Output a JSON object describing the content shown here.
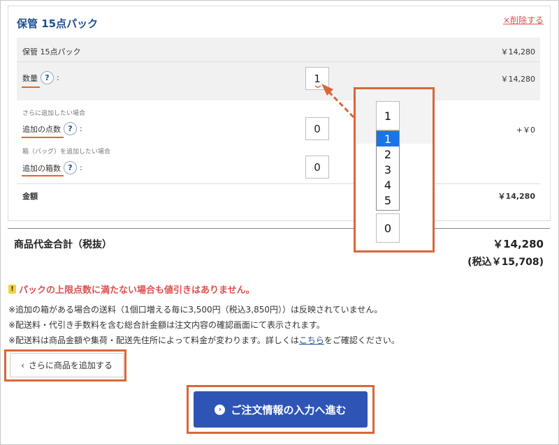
{
  "card": {
    "title": "保管 15点パック",
    "delete_label": "×削除する",
    "item_row": {
      "label": "保管 15点パック",
      "price": "￥14,280"
    },
    "quantity_row": {
      "label": "数量",
      "help": "?",
      "colon": ":",
      "value": "1",
      "price": "￥14,280"
    },
    "extra_items": {
      "note": "さらに追加したい場合",
      "label": "追加の点数",
      "help": "?",
      "colon": ":",
      "value": "0",
      "price": "+￥0"
    },
    "extra_boxes": {
      "note": "箱（バッグ）を追加したい場合",
      "label": "追加の箱数",
      "help": "?",
      "colon": ":",
      "value": "0"
    },
    "amount_row": {
      "label": "金額",
      "price": "￥14,280"
    }
  },
  "totals": {
    "label": "商品代金合計（税抜）",
    "price": "￥14,280",
    "tax_included": "(税込￥15,708)"
  },
  "warning": {
    "icon": "!",
    "text": "パックの上限点数に満たない場合も値引きはありません。"
  },
  "notes": [
    "※追加の箱がある場合の送料（1個口増える毎に3,500円（税込3,850円））は反映されていません。",
    "※配送料・代引き手数料を含む総合計金額は注文内容の確認画面にて表示されます。"
  ],
  "note3": {
    "before": "※配送料は商品金額や集荷・配送先住所によって料金が変わります。詳しくは",
    "link": "こちら",
    "after": "をご確認ください。"
  },
  "buttons": {
    "add_more": "さらに商品を追加する",
    "add_more_chevron": "‹",
    "proceed": "ご注文情報の入力へ進む",
    "proceed_icon": "›"
  },
  "zoom": {
    "selected_display": "1",
    "options": [
      "1",
      "2",
      "3",
      "4",
      "5"
    ],
    "selected_index": 0,
    "below_value": "0"
  },
  "colors": {
    "title_blue": "#1d4f91",
    "warning_red": "#e05050",
    "annotation_orange": "#d9663a",
    "proceed_blue": "#2e55b6",
    "selection_blue": "#1a73e8"
  }
}
